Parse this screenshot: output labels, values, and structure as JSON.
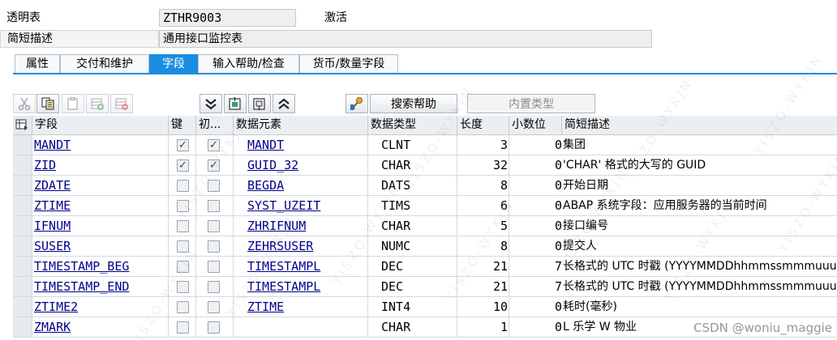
{
  "header": {
    "table_label": "透明表",
    "table_name": "ZTHR9003",
    "status": "激活",
    "desc_label": "简短描述",
    "desc_value": "通用接口监控表"
  },
  "tabs": [
    {
      "label": "属性",
      "active": false
    },
    {
      "label": "交付和维护",
      "active": false
    },
    {
      "label": "字段",
      "active": true
    },
    {
      "label": "输入帮助/检查",
      "active": false
    },
    {
      "label": "货币/数量字段",
      "active": false
    }
  ],
  "toolbar": {
    "icons": [
      "cut-icon",
      "copy-icon",
      "paste-icon",
      "insert-row-icon",
      "delete-row-icon",
      "collapse-icon",
      "insert-structure-icon",
      "append-structure-icon",
      "expand-icon",
      "search-help-key-icon"
    ],
    "search_help_label": "搜索帮助",
    "builtin_type_label": "内置类型"
  },
  "columns": {
    "field": "字段",
    "key": "键",
    "initial": "初...",
    "data_element": "数据元素",
    "data_type": "数据类型",
    "length": "长度",
    "decimals": "小数位",
    "short_desc": "简短描述"
  },
  "rows": [
    {
      "field": "MANDT",
      "key": true,
      "initial": true,
      "data_element": "MANDT",
      "data_type": "CLNT",
      "length": "3",
      "decimals": "0",
      "desc": "集团"
    },
    {
      "field": "ZID",
      "key": true,
      "initial": true,
      "data_element": "GUID_32",
      "data_type": "CHAR",
      "length": "32",
      "decimals": "0",
      "desc": "'CHAR' 格式的大写的 GUID"
    },
    {
      "field": "ZDATE",
      "key": false,
      "initial": false,
      "data_element": "BEGDA",
      "data_type": "DATS",
      "length": "8",
      "decimals": "0",
      "desc": "开始日期"
    },
    {
      "field": "ZTIME",
      "key": false,
      "initial": false,
      "data_element": "SYST_UZEIT",
      "data_type": "TIMS",
      "length": "6",
      "decimals": "0",
      "desc": "ABAP 系统字段：应用服务器的当前时间"
    },
    {
      "field": "IFNUM",
      "key": false,
      "initial": false,
      "data_element": "ZHRIFNUM",
      "data_type": "CHAR",
      "length": "5",
      "decimals": "0",
      "desc": "接口编号"
    },
    {
      "field": "SUSER",
      "key": false,
      "initial": false,
      "data_element": "ZEHRSUSER",
      "data_type": "NUMC",
      "length": "8",
      "decimals": "0",
      "desc": "提交人"
    },
    {
      "field": "TIMESTAMP_BEG",
      "key": false,
      "initial": false,
      "data_element": "TIMESTAMPL",
      "data_type": "DEC",
      "length": "21",
      "decimals": "7",
      "desc": "长格式的 UTC 时戳 (YYYYMMDDhhmmssmmmuuu"
    },
    {
      "field": "TIMESTAMP_END",
      "key": false,
      "initial": false,
      "data_element": "TIMESTAMPL",
      "data_type": "DEC",
      "length": "21",
      "decimals": "7",
      "desc": "长格式的 UTC 时戳 (YYYYMMDDhhmmssmmmuuu"
    },
    {
      "field": "ZTIME2",
      "key": false,
      "initial": false,
      "data_element": "ZTIME",
      "data_type": "INT4",
      "length": "10",
      "decimals": "0",
      "desc": "耗时(毫秒)"
    },
    {
      "field": "ZMARK",
      "key": false,
      "initial": false,
      "data_element": "",
      "data_type": "CHAR",
      "length": "1",
      "decimals": "0",
      "desc": "L 乐学  W 物业"
    }
  ],
  "watermark": {
    "text": "YISZO-WYKJN",
    "csdn": "CSDN @woniu_maggie"
  },
  "colors": {
    "accent": "#1a8de0",
    "link": "#00008a"
  }
}
